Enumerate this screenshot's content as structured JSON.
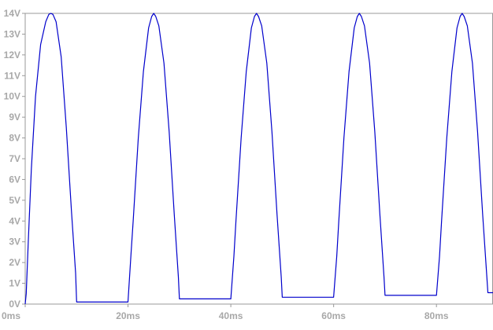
{
  "chart_data": {
    "type": "line",
    "title": "",
    "xlabel": "",
    "ylabel": "",
    "xlim": [
      0,
      91
    ],
    "ylim": [
      0,
      14
    ],
    "x_ticks": [
      0,
      20,
      40,
      60,
      80
    ],
    "x_tick_labels": [
      "0ms",
      "20ms",
      "40ms",
      "60ms",
      "80ms"
    ],
    "y_ticks": [
      0,
      1,
      2,
      3,
      4,
      5,
      6,
      7,
      8,
      9,
      10,
      11,
      12,
      13,
      14
    ],
    "y_tick_labels": [
      "0V",
      "1V",
      "2V",
      "3V",
      "4V",
      "5V",
      "6V",
      "7V",
      "8V",
      "9V",
      "10V",
      "11V",
      "12V",
      "13V",
      "14V"
    ],
    "grid": false,
    "colors": {
      "line": "#0000cc",
      "frame": "#999999",
      "tick_label": "#a8a8a8",
      "background": "#ffffff"
    },
    "series": [
      {
        "x": [
          0,
          0.2,
          0.6,
          1.2,
          2.0,
          3.0,
          4.0,
          4.6,
          5.0,
          5.4,
          6.0,
          7.0,
          8.0,
          9.0,
          9.8,
          10.0,
          15.0,
          20.0,
          20.6,
          21.0,
          22.0,
          23.0,
          24.0,
          24.6,
          25.0,
          25.4,
          26.0,
          27.0,
          28.0,
          29.0,
          29.8,
          30.0,
          35.0,
          40.0,
          40.6,
          41.0,
          42.0,
          43.0,
          44.0,
          44.6,
          45.0,
          45.4,
          46.0,
          47.0,
          48.0,
          49.0,
          49.8,
          50.0,
          55.0,
          60.0,
          60.6,
          61.0,
          62.0,
          63.0,
          64.0,
          64.6,
          65.0,
          65.4,
          66.0,
          67.0,
          68.0,
          69.0,
          69.8,
          70.0,
          75.0,
          80.0,
          80.6,
          81.0,
          82.0,
          83.0,
          84.0,
          84.6,
          85.0,
          85.4,
          86.0,
          87.0,
          88.0,
          89.0,
          89.8,
          90.0,
          91.0
        ],
        "values": [
          0.0,
          0.5,
          3.0,
          6.5,
          10.0,
          12.5,
          13.6,
          13.95,
          14.0,
          13.95,
          13.6,
          11.9,
          8.5,
          4.5,
          1.5,
          0.1,
          0.1,
          0.1,
          2.5,
          4.0,
          8.0,
          11.2,
          13.3,
          13.85,
          14.0,
          13.85,
          13.4,
          11.6,
          8.3,
          4.3,
          1.3,
          0.25,
          0.25,
          0.25,
          2.3,
          4.0,
          8.0,
          11.2,
          13.3,
          13.85,
          14.0,
          13.85,
          13.4,
          11.6,
          8.3,
          4.3,
          1.3,
          0.33,
          0.33,
          0.33,
          2.3,
          4.0,
          8.0,
          11.2,
          13.3,
          13.85,
          14.0,
          13.85,
          13.4,
          11.6,
          8.3,
          4.3,
          1.3,
          0.42,
          0.42,
          0.42,
          2.3,
          4.0,
          8.0,
          11.2,
          13.3,
          13.85,
          14.0,
          13.85,
          13.4,
          11.6,
          8.3,
          4.3,
          1.3,
          0.55,
          0.55
        ]
      }
    ]
  }
}
